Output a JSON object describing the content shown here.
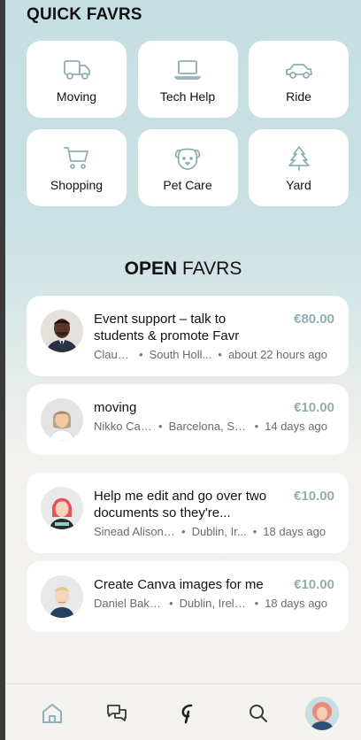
{
  "quick_favrs": {
    "title": "QUICK FAVRS",
    "items": [
      {
        "label": "Moving",
        "icon": "truck-icon"
      },
      {
        "label": "Tech Help",
        "icon": "laptop-icon"
      },
      {
        "label": "Ride",
        "icon": "car-icon"
      },
      {
        "label": "Shopping",
        "icon": "shopping-cart-icon"
      },
      {
        "label": "Pet Care",
        "icon": "dog-icon"
      },
      {
        "label": "Yard",
        "icon": "tree-icon"
      }
    ]
  },
  "open_favrs": {
    "title_strong": "OPEN",
    "title_light": "FAVRS",
    "items": [
      {
        "title": "Event support – talk to students & promote Favr",
        "price": "€80.00",
        "client": "Claud...",
        "location": "South Holl...",
        "time": "about 22 hours ago"
      },
      {
        "title": "moving",
        "price": "€10.00",
        "client": "Nikko Cas...",
        "location": "Barcelona, Sp...",
        "time": "14 days ago"
      },
      {
        "title": "Help me edit and go over two documents so they're...",
        "price": "€10.00",
        "client": "Sinead Alison ...",
        "location": "Dublin, Ir...",
        "time": "18 days ago"
      },
      {
        "title": "Create Canva images for me",
        "price": "€10.00",
        "client": "Daniel Baka...",
        "location": "Dublin, Irela...",
        "time": "18 days ago"
      }
    ]
  },
  "bottom_nav": {
    "items": [
      "home-icon",
      "chat-icon",
      "favr-logo-icon",
      "search-icon",
      "profile-avatar"
    ]
  },
  "colors": {
    "accent": "#93adb2",
    "icon_stroke": "#8fb0b5",
    "card_bg": "#ffffff"
  }
}
